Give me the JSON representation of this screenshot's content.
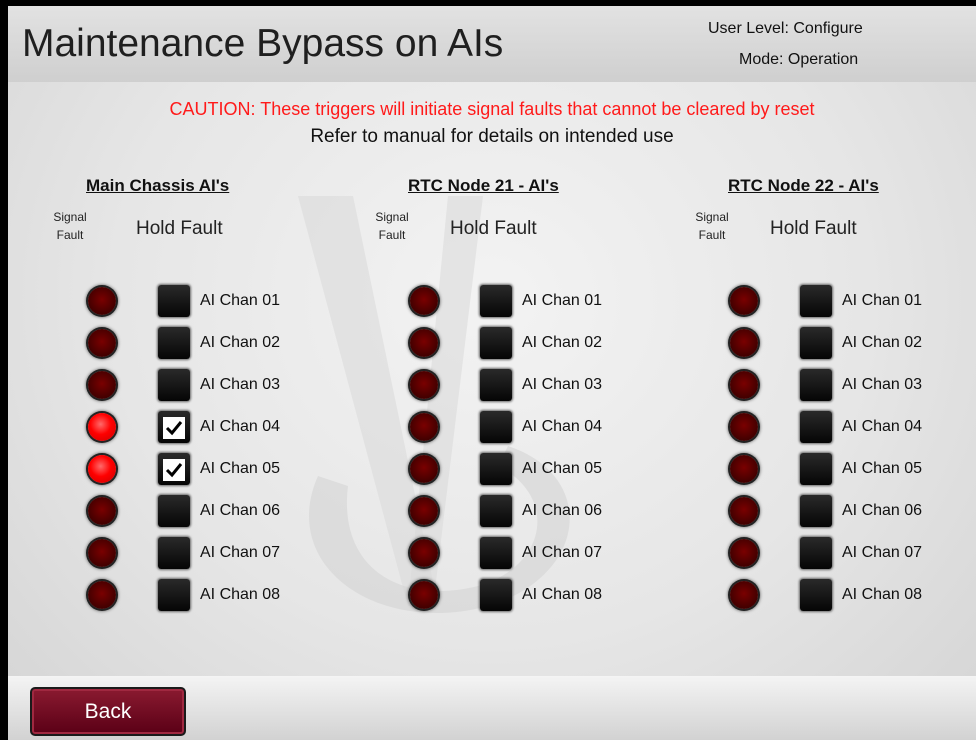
{
  "header": {
    "title": "Maintenance Bypass on AIs",
    "user_level": "User Level: Configure",
    "mode": "Mode: Operation"
  },
  "caution": "CAUTION: These triggers will initiate signal faults that cannot be cleared by reset",
  "refer": "Refer to manual for details on intended use",
  "labels": {
    "signal_fault_line1": "Signal",
    "signal_fault_line2": "Fault",
    "hold_fault": "Hold Fault"
  },
  "groups": [
    {
      "title": "Main Chassis AI's",
      "channels": [
        {
          "label": "AI Chan 01",
          "signal_fault": false,
          "hold_fault": false
        },
        {
          "label": "AI Chan 02",
          "signal_fault": false,
          "hold_fault": false
        },
        {
          "label": "AI Chan 03",
          "signal_fault": false,
          "hold_fault": false
        },
        {
          "label": "AI Chan 04",
          "signal_fault": true,
          "hold_fault": true
        },
        {
          "label": "AI Chan 05",
          "signal_fault": true,
          "hold_fault": true
        },
        {
          "label": "AI Chan 06",
          "signal_fault": false,
          "hold_fault": false
        },
        {
          "label": "AI Chan 07",
          "signal_fault": false,
          "hold_fault": false
        },
        {
          "label": "AI Chan 08",
          "signal_fault": false,
          "hold_fault": false
        }
      ]
    },
    {
      "title": "RTC Node 21 - AI's",
      "channels": [
        {
          "label": "AI Chan 01",
          "signal_fault": false,
          "hold_fault": false
        },
        {
          "label": "AI Chan 02",
          "signal_fault": false,
          "hold_fault": false
        },
        {
          "label": "AI Chan 03",
          "signal_fault": false,
          "hold_fault": false
        },
        {
          "label": "AI Chan 04",
          "signal_fault": false,
          "hold_fault": false
        },
        {
          "label": "AI Chan 05",
          "signal_fault": false,
          "hold_fault": false
        },
        {
          "label": "AI Chan 06",
          "signal_fault": false,
          "hold_fault": false
        },
        {
          "label": "AI Chan 07",
          "signal_fault": false,
          "hold_fault": false
        },
        {
          "label": "AI Chan 08",
          "signal_fault": false,
          "hold_fault": false
        }
      ]
    },
    {
      "title": "RTC Node 22 - AI's",
      "channels": [
        {
          "label": "AI Chan 01",
          "signal_fault": false,
          "hold_fault": false
        },
        {
          "label": "AI Chan 02",
          "signal_fault": false,
          "hold_fault": false
        },
        {
          "label": "AI Chan 03",
          "signal_fault": false,
          "hold_fault": false
        },
        {
          "label": "AI Chan 04",
          "signal_fault": false,
          "hold_fault": false
        },
        {
          "label": "AI Chan 05",
          "signal_fault": false,
          "hold_fault": false
        },
        {
          "label": "AI Chan 06",
          "signal_fault": false,
          "hold_fault": false
        },
        {
          "label": "AI Chan 07",
          "signal_fault": false,
          "hold_fault": false
        },
        {
          "label": "AI Chan 08",
          "signal_fault": false,
          "hold_fault": false
        }
      ]
    }
  ],
  "footer": {
    "back_label": "Back"
  },
  "colors": {
    "caution": "#ff1a1a",
    "led_on": "#ff0000",
    "led_off": "#4a0000",
    "back_button": "#6e0a22"
  }
}
